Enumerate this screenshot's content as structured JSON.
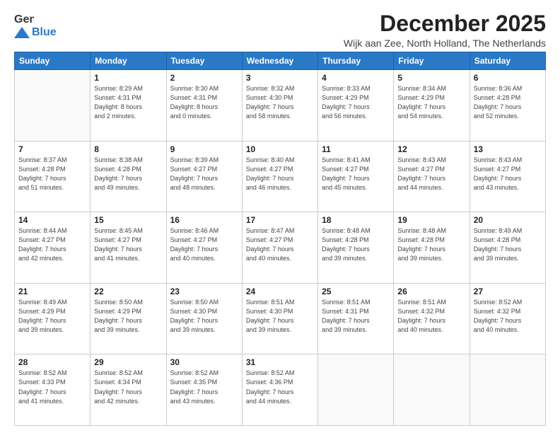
{
  "logo": {
    "line1": "General",
    "line2": "Blue"
  },
  "header": {
    "month": "December 2025",
    "location": "Wijk aan Zee, North Holland, The Netherlands"
  },
  "weekdays": [
    "Sunday",
    "Monday",
    "Tuesday",
    "Wednesday",
    "Thursday",
    "Friday",
    "Saturday"
  ],
  "weeks": [
    [
      {
        "day": "",
        "info": ""
      },
      {
        "day": "1",
        "info": "Sunrise: 8:29 AM\nSunset: 4:31 PM\nDaylight: 8 hours\nand 2 minutes."
      },
      {
        "day": "2",
        "info": "Sunrise: 8:30 AM\nSunset: 4:31 PM\nDaylight: 8 hours\nand 0 minutes."
      },
      {
        "day": "3",
        "info": "Sunrise: 8:32 AM\nSunset: 4:30 PM\nDaylight: 7 hours\nand 58 minutes."
      },
      {
        "day": "4",
        "info": "Sunrise: 8:33 AM\nSunset: 4:29 PM\nDaylight: 7 hours\nand 56 minutes."
      },
      {
        "day": "5",
        "info": "Sunrise: 8:34 AM\nSunset: 4:29 PM\nDaylight: 7 hours\nand 54 minutes."
      },
      {
        "day": "6",
        "info": "Sunrise: 8:36 AM\nSunset: 4:28 PM\nDaylight: 7 hours\nand 52 minutes."
      }
    ],
    [
      {
        "day": "7",
        "info": "Sunrise: 8:37 AM\nSunset: 4:28 PM\nDaylight: 7 hours\nand 51 minutes."
      },
      {
        "day": "8",
        "info": "Sunrise: 8:38 AM\nSunset: 4:28 PM\nDaylight: 7 hours\nand 49 minutes."
      },
      {
        "day": "9",
        "info": "Sunrise: 8:39 AM\nSunset: 4:27 PM\nDaylight: 7 hours\nand 48 minutes."
      },
      {
        "day": "10",
        "info": "Sunrise: 8:40 AM\nSunset: 4:27 PM\nDaylight: 7 hours\nand 46 minutes."
      },
      {
        "day": "11",
        "info": "Sunrise: 8:41 AM\nSunset: 4:27 PM\nDaylight: 7 hours\nand 45 minutes."
      },
      {
        "day": "12",
        "info": "Sunrise: 8:43 AM\nSunset: 4:27 PM\nDaylight: 7 hours\nand 44 minutes."
      },
      {
        "day": "13",
        "info": "Sunrise: 8:43 AM\nSunset: 4:27 PM\nDaylight: 7 hours\nand 43 minutes."
      }
    ],
    [
      {
        "day": "14",
        "info": "Sunrise: 8:44 AM\nSunset: 4:27 PM\nDaylight: 7 hours\nand 42 minutes."
      },
      {
        "day": "15",
        "info": "Sunrise: 8:45 AM\nSunset: 4:27 PM\nDaylight: 7 hours\nand 41 minutes."
      },
      {
        "day": "16",
        "info": "Sunrise: 8:46 AM\nSunset: 4:27 PM\nDaylight: 7 hours\nand 40 minutes."
      },
      {
        "day": "17",
        "info": "Sunrise: 8:47 AM\nSunset: 4:27 PM\nDaylight: 7 hours\nand 40 minutes."
      },
      {
        "day": "18",
        "info": "Sunrise: 8:48 AM\nSunset: 4:28 PM\nDaylight: 7 hours\nand 39 minutes."
      },
      {
        "day": "19",
        "info": "Sunrise: 8:48 AM\nSunset: 4:28 PM\nDaylight: 7 hours\nand 39 minutes."
      },
      {
        "day": "20",
        "info": "Sunrise: 8:49 AM\nSunset: 4:28 PM\nDaylight: 7 hours\nand 39 minutes."
      }
    ],
    [
      {
        "day": "21",
        "info": "Sunrise: 8:49 AM\nSunset: 4:29 PM\nDaylight: 7 hours\nand 39 minutes."
      },
      {
        "day": "22",
        "info": "Sunrise: 8:50 AM\nSunset: 4:29 PM\nDaylight: 7 hours\nand 39 minutes."
      },
      {
        "day": "23",
        "info": "Sunrise: 8:50 AM\nSunset: 4:30 PM\nDaylight: 7 hours\nand 39 minutes."
      },
      {
        "day": "24",
        "info": "Sunrise: 8:51 AM\nSunset: 4:30 PM\nDaylight: 7 hours\nand 39 minutes."
      },
      {
        "day": "25",
        "info": "Sunrise: 8:51 AM\nSunset: 4:31 PM\nDaylight: 7 hours\nand 39 minutes."
      },
      {
        "day": "26",
        "info": "Sunrise: 8:51 AM\nSunset: 4:32 PM\nDaylight: 7 hours\nand 40 minutes."
      },
      {
        "day": "27",
        "info": "Sunrise: 8:52 AM\nSunset: 4:32 PM\nDaylight: 7 hours\nand 40 minutes."
      }
    ],
    [
      {
        "day": "28",
        "info": "Sunrise: 8:52 AM\nSunset: 4:33 PM\nDaylight: 7 hours\nand 41 minutes."
      },
      {
        "day": "29",
        "info": "Sunrise: 8:52 AM\nSunset: 4:34 PM\nDaylight: 7 hours\nand 42 minutes."
      },
      {
        "day": "30",
        "info": "Sunrise: 8:52 AM\nSunset: 4:35 PM\nDaylight: 7 hours\nand 43 minutes."
      },
      {
        "day": "31",
        "info": "Sunrise: 8:52 AM\nSunset: 4:36 PM\nDaylight: 7 hours\nand 44 minutes."
      },
      {
        "day": "",
        "info": ""
      },
      {
        "day": "",
        "info": ""
      },
      {
        "day": "",
        "info": ""
      }
    ]
  ]
}
